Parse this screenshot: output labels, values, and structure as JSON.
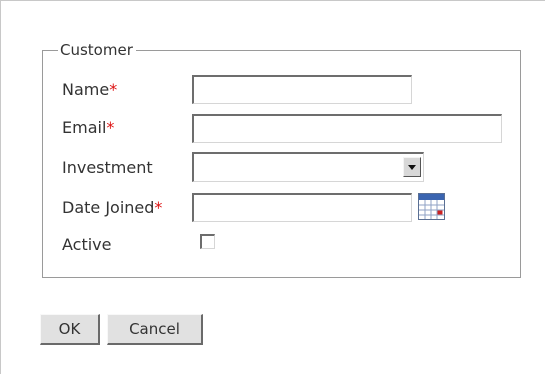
{
  "form": {
    "legend": "Customer",
    "required_marker": "*",
    "fields": {
      "name": {
        "label": "Name",
        "required": true,
        "value": ""
      },
      "email": {
        "label": "Email",
        "required": true,
        "value": ""
      },
      "investment": {
        "label": "Investment",
        "required": false,
        "selected": ""
      },
      "date_joined": {
        "label": "Date Joined",
        "required": true,
        "value": ""
      },
      "active": {
        "label": "Active",
        "required": false,
        "checked": false
      }
    }
  },
  "buttons": {
    "ok_label": "OK",
    "cancel_label": "Cancel"
  },
  "icons": {
    "investment_dropdown": "chevron-down-icon",
    "date_picker": "calendar-icon"
  },
  "colors": {
    "required": "#dd1111",
    "calendar_accent": "#3a64b0"
  }
}
